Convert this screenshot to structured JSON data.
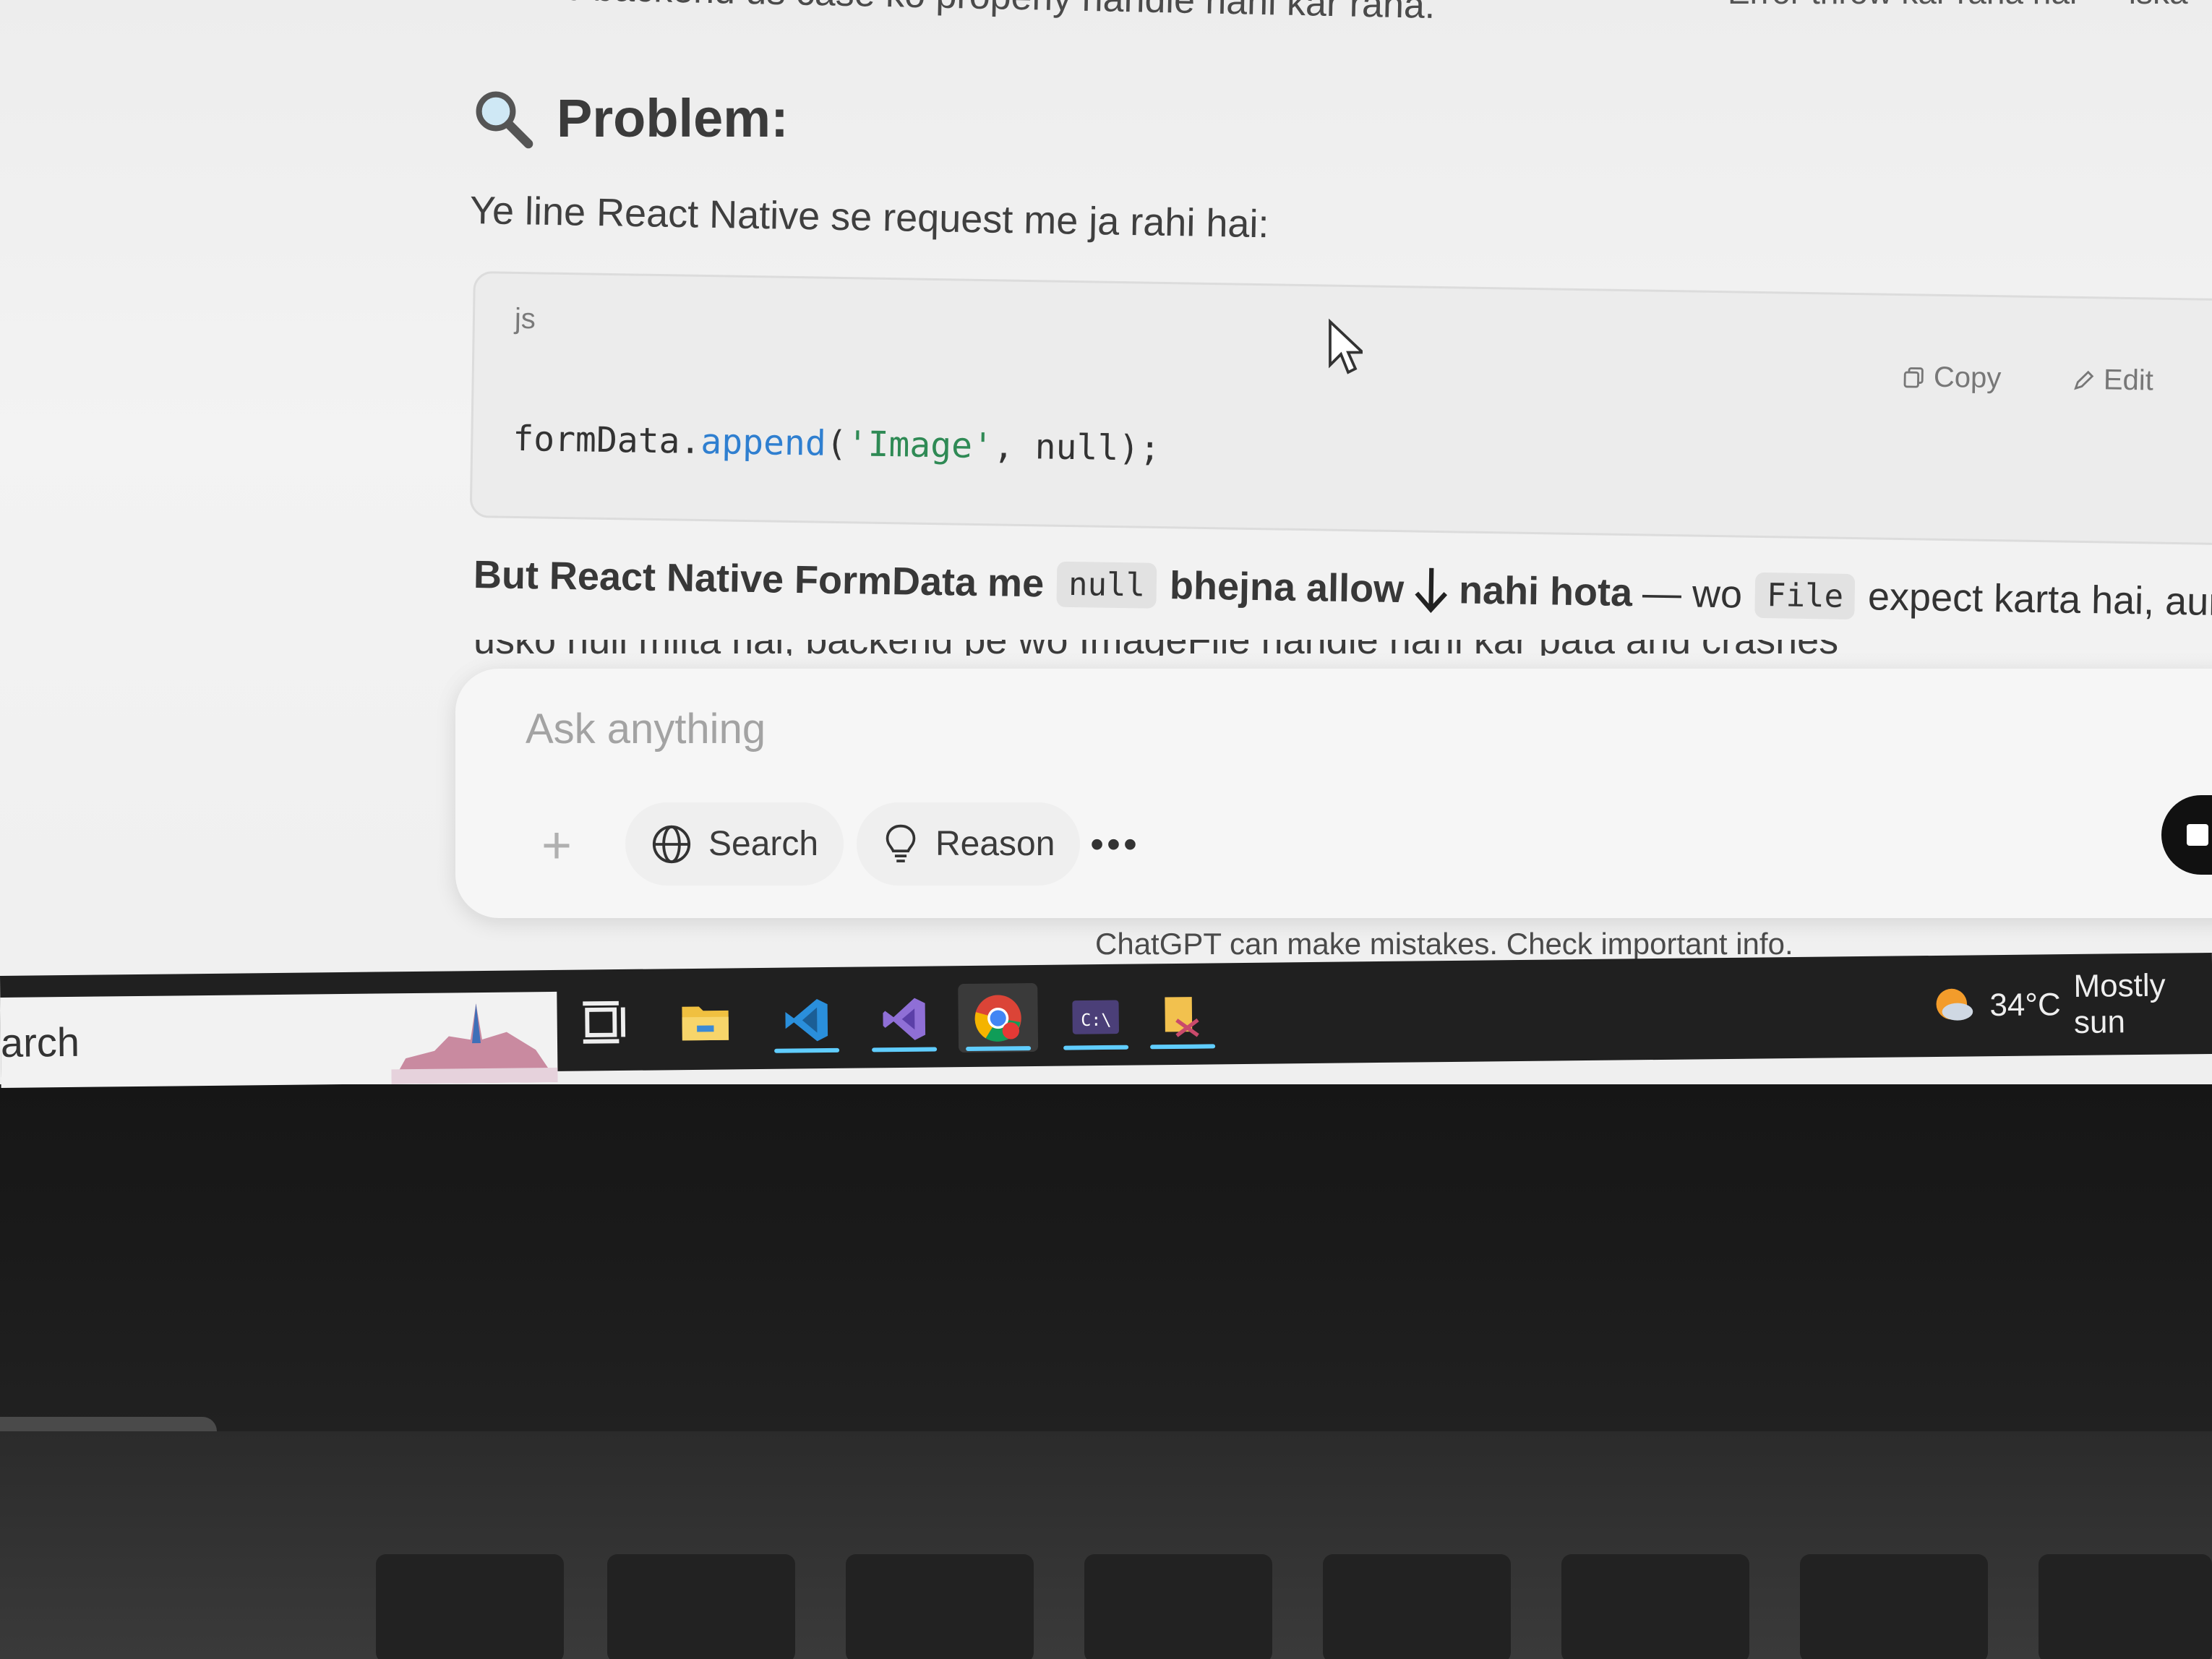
{
  "chat": {
    "top_line_left": "matlab backend us case ko properly handle nahi kar raha.",
    "top_line_right": "Error throw kar raha hai — iska",
    "problem_heading": "Problem:",
    "intro_line": "Ye line React Native se request me ja rahi hai:",
    "code_block": {
      "language": "js",
      "copy_label": "Copy",
      "edit_label": "Edit",
      "code_object": "formData.",
      "code_fn": "append",
      "code_open": "(",
      "code_str": "'Image'",
      "code_rest": ", null);"
    },
    "but_line": {
      "part1": "But React Native FormData me",
      "code1": "null",
      "part2": "bhejna allow",
      "part3": "nahi hota",
      "part4": "— wo",
      "code2": "File",
      "part5": "expect karta hai, aur jab"
    },
    "cut_line": "usko null milta hai, backend pe wo ImageFile handle nahi kar pata and crashes"
  },
  "composer": {
    "placeholder": "Ask anything",
    "search_label": "Search",
    "reason_label": "Reason",
    "more_label": "•••",
    "plus_label": "+"
  },
  "disclaimer": "ChatGPT can make mistakes. Check important info.",
  "taskbar": {
    "search_text": "arch",
    "weather_temp": "34°C",
    "weather_desc": "Mostly sun",
    "icons": [
      "task-view-icon",
      "file-explorer-icon",
      "vscode-icon",
      "visual-studio-icon",
      "chrome-icon",
      "terminal-icon",
      "snipping-tool-icon"
    ]
  },
  "colors": {
    "accent_underline": "#60cdff",
    "code_function": "#2f7fd0",
    "code_string": "#2f8a55"
  }
}
